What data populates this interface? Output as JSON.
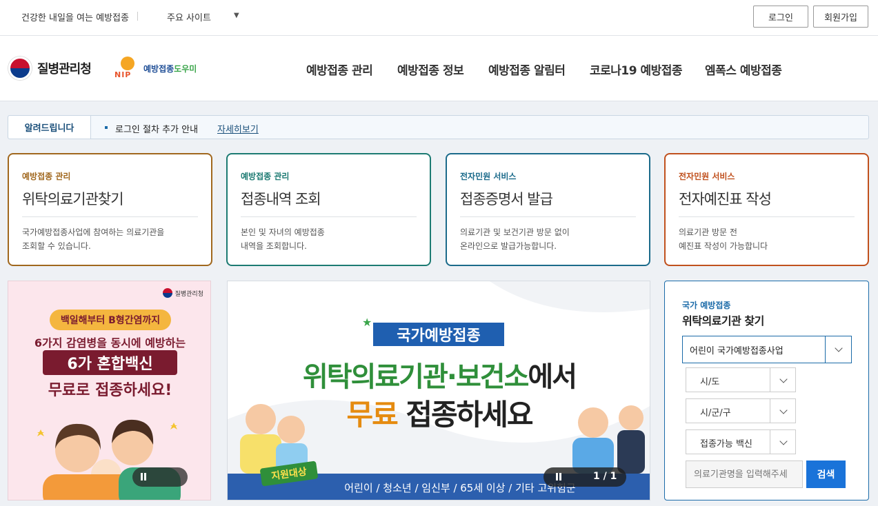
{
  "topbar": {
    "slogan": "건강한 내일을 여는 예방접종",
    "sites_label": "주요 사이트",
    "caret": "▼",
    "login_label": "로그인",
    "join_label": "회원가입"
  },
  "header": {
    "kdca_name": "질병관리청",
    "nip_letters": "NIP",
    "nip_name_main": "예방접종",
    "nip_name_accent": "도우미",
    "nav": [
      "예방접종 관리",
      "예방접종 정보",
      "예방접종 알림터",
      "코로나19 예방접종",
      "엠폭스 예방접종"
    ]
  },
  "notice": {
    "label": "알려드립니다",
    "text": "로그인 절차 추가 안내",
    "more_label": "자세히보기"
  },
  "cards": [
    {
      "category": "예방접종 관리",
      "title": "위탁의료기관찾기",
      "desc1": "국가예방접종사업에 참여하는 의료기관을",
      "desc2": "조회할 수 있습니다.",
      "color": "#a0671d"
    },
    {
      "category": "예방접종 관리",
      "title": "접종내역 조회",
      "desc1": "본인 및 자녀의 예방접종",
      "desc2": "내역을 조회합니다.",
      "color": "#1c7a72"
    },
    {
      "category": "전자민원 서비스",
      "title": "접종증명서 발급",
      "desc1": "의료기관 및 보건기관 방문 없이",
      "desc2": "온라인으로 발급가능합니다.",
      "color": "#1a6a8a"
    },
    {
      "category": "전자민원 서비스",
      "title": "전자예진표 작성",
      "desc1": "의료기관 방문 전",
      "desc2": "예진표 작성이 가능합니다",
      "color": "#c0501d"
    }
  ],
  "promo": {
    "brand": "질병관리청",
    "pill": "백일해부터 B형간염까지",
    "line2": "6가지 감염병을 동시에 예방하는",
    "line3": "6가 혼합백신",
    "line4": "무료로 접종하세요!"
  },
  "banner": {
    "tag": "국가예방접종",
    "headline1_green": "위탁의료기관·보건소",
    "headline1_dark": "에서",
    "headline2_orange": "무료",
    "headline2_dark": " 접종하세요",
    "badge": "지원대상",
    "targets": "어린이 / 청소년 / 임신부 / 65세 이상 / 기타 고위험군",
    "counter": "1 / 1"
  },
  "search": {
    "category": "국가 예방접종",
    "title": "위탁의료기관 찾기",
    "program_value": "어린이 국가예방접종사업",
    "sido": "시/도",
    "sigungu": "시/군/구",
    "vaccine": "접종가능 백신",
    "name_placeholder": "의료기관명을 입력해주세",
    "search_label": "검색"
  }
}
